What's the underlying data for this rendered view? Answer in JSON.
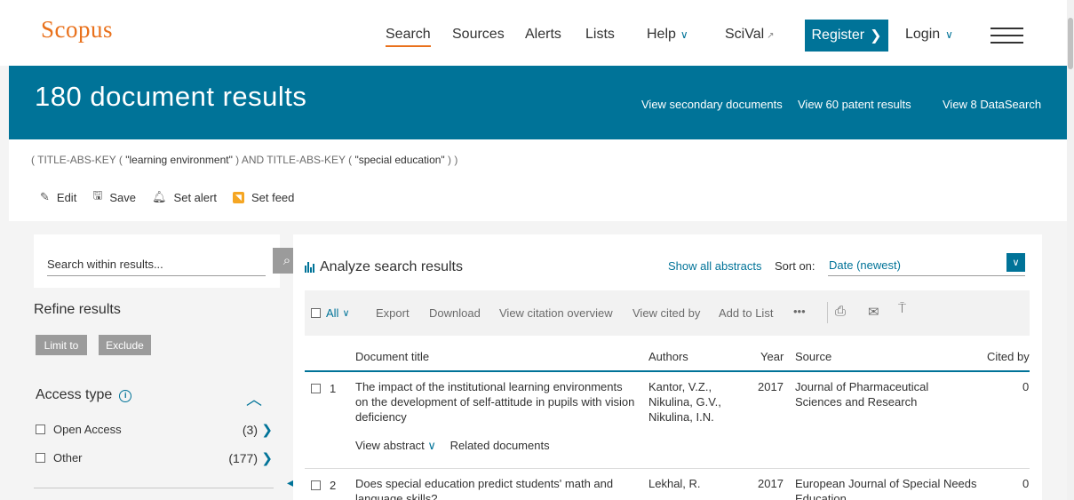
{
  "header": {
    "logo": "Scopus",
    "nav": [
      "Search",
      "Sources",
      "Alerts",
      "Lists",
      "Help",
      "SciVal"
    ],
    "register": "Register",
    "login": "Login"
  },
  "banner": {
    "title": "180 document results",
    "links": [
      "View secondary documents",
      "View 60 patent results",
      "View 8 DataSearch"
    ]
  },
  "query": {
    "parts": [
      "( TITLE-ABS-KEY ( ",
      "\"learning environment\"",
      " ) AND TITLE-ABS-KEY ( ",
      "\"special education\"",
      " ) )"
    ]
  },
  "query_actions": [
    "Edit",
    "Save",
    "Set alert",
    "Set feed"
  ],
  "sidebar": {
    "search_placeholder": "Search within results...",
    "refine_title": "Refine results",
    "limit_to": "Limit to",
    "exclude": "Exclude",
    "access_title": "Access type",
    "facets": [
      {
        "label": "Open Access",
        "count": "(3)"
      },
      {
        "label": "Other",
        "count": "(177)"
      }
    ]
  },
  "results": {
    "analyze": "Analyze search results",
    "show_abstracts": "Show all abstracts",
    "sort_label": "Sort on:",
    "sort_value": "Date (newest)",
    "toolbar": {
      "all": "All",
      "items": [
        "Export",
        "Download",
        "View citation overview",
        "View cited by",
        "Add to List",
        "•••"
      ]
    },
    "columns": [
      "Document title",
      "Authors",
      "Year",
      "Source",
      "Cited by"
    ],
    "rows": [
      {
        "num": "1",
        "title": "The impact of the institutional learning environments on the development of self-attitude in pupils with vision deficiency",
        "authors": "Kantor, V.Z., Nikulina, G.V., Nikulina, I.N.",
        "year": "2017",
        "source": "Journal of Pharmaceutical Sciences and Research",
        "cited": "0",
        "view_abstract": "View abstract",
        "related": "Related documents"
      },
      {
        "num": "2",
        "title": "Does special education predict students' math and language skills?",
        "authors": "Lekhal, R.",
        "year": "2017",
        "source": "European Journal of Special Needs Education",
        "cited": "0"
      }
    ]
  },
  "colors": {
    "accent": "#007398",
    "brand": "#e9711c"
  },
  "icons": [
    "edit-icon",
    "save-icon",
    "bell-icon",
    "rss-icon",
    "search-icon",
    "info-icon",
    "print-icon",
    "email-icon",
    "bibliography-icon",
    "bar-chart-icon"
  ]
}
